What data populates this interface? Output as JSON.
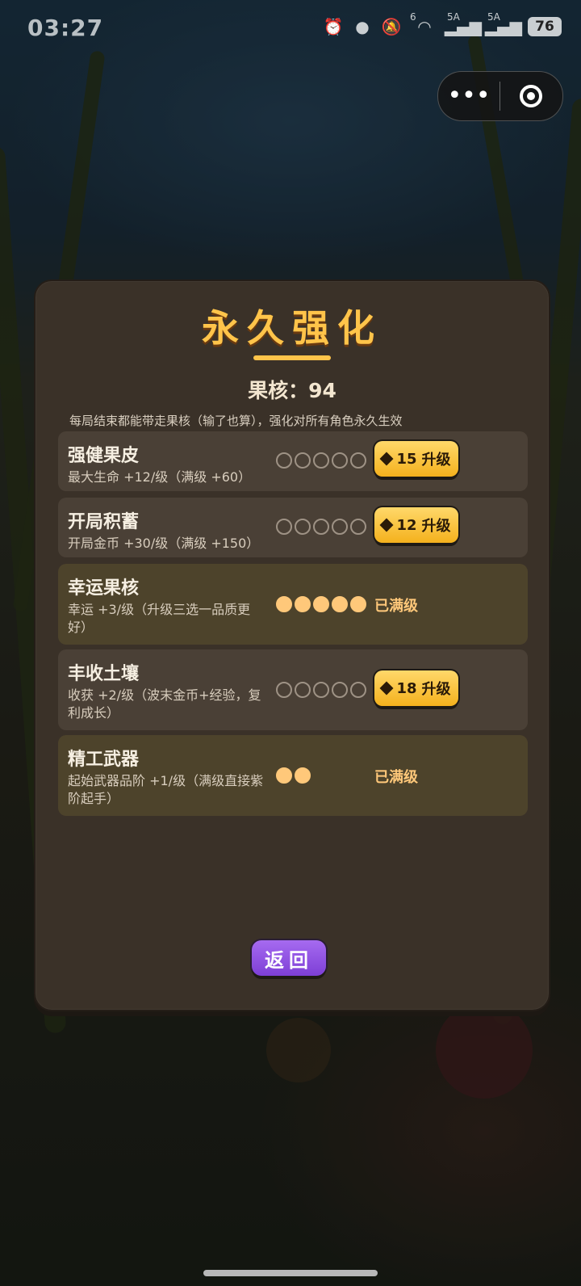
{
  "status_bar": {
    "time": "03:27",
    "network_1": "5A",
    "network_2": "5A",
    "wifi_badge": "6",
    "battery": "76"
  },
  "capsule": {
    "more_icon": "more-dots-icon",
    "close_icon": "target-icon"
  },
  "panel": {
    "title": "永久强化",
    "core_label": "果核：94",
    "hint": "每局结束都能带走果核（输了也算），强化对所有角色永久生效"
  },
  "upgrades": [
    {
      "name": "强健果皮",
      "desc": "最大生命 +12/级（满级 +60）",
      "level": 0,
      "max_level": 5,
      "cost": "15",
      "action": "升级",
      "maxed_label": ""
    },
    {
      "name": "开局积蓄",
      "desc": "开局金币 +30/级（满级 +150）",
      "level": 0,
      "max_level": 5,
      "cost": "12",
      "action": "升级",
      "maxed_label": ""
    },
    {
      "name": "幸运果核",
      "desc": "幸运 +3/级（升级三选一品质更好）",
      "level": 5,
      "max_level": 5,
      "cost": "",
      "action": "",
      "maxed_label": "已满级"
    },
    {
      "name": "丰收土壤",
      "desc": "收获 +2/级（波末金币+经验，复利成长）",
      "level": 0,
      "max_level": 5,
      "cost": "18",
      "action": "升级",
      "maxed_label": ""
    },
    {
      "name": "精工武器",
      "desc": "起始武器品阶 +1/级（满级直接紫阶起手）",
      "level": 2,
      "max_level": 2,
      "cost": "",
      "action": "",
      "maxed_label": "已满级"
    }
  ],
  "back_label": "返回",
  "colors": {
    "accent": "#ffc44a",
    "button": "#f4b11d",
    "back_button": "#8a4ee0",
    "panel": "#3a3128"
  }
}
